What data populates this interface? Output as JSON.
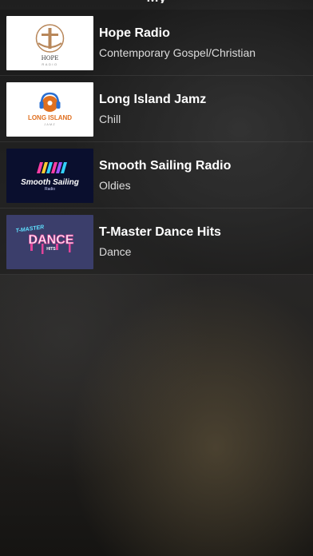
{
  "header": {
    "title": "My"
  },
  "stations": [
    {
      "name": "Hope Radio",
      "genre": "Contemporary Gospel/Christian",
      "logo_text": "HOPE",
      "logo_subtext": "RADIO",
      "logo_bg": "#ffffff",
      "logo_accent": "#b8875a"
    },
    {
      "name": "Long Island Jamz",
      "genre": "Chill",
      "logo_text": "LONG ISLAND",
      "logo_subtext": "JAMZ",
      "logo_bg": "#ffffff",
      "logo_accent": "#e07020"
    },
    {
      "name": "Smooth Sailing Radio",
      "genre": "Oldies",
      "logo_text": "Smooth Sailing",
      "logo_subtext": "Radio",
      "logo_bg": "#0a0f2e",
      "logo_accent": "#ff3ea5"
    },
    {
      "name": "T-Master Dance Hits",
      "genre": "Dance",
      "logo_text": "DANCE",
      "logo_subtext": "HITS",
      "logo_top": "T-MASTER",
      "logo_bg": "#3b3e6b",
      "logo_accent": "#e2449a"
    }
  ]
}
